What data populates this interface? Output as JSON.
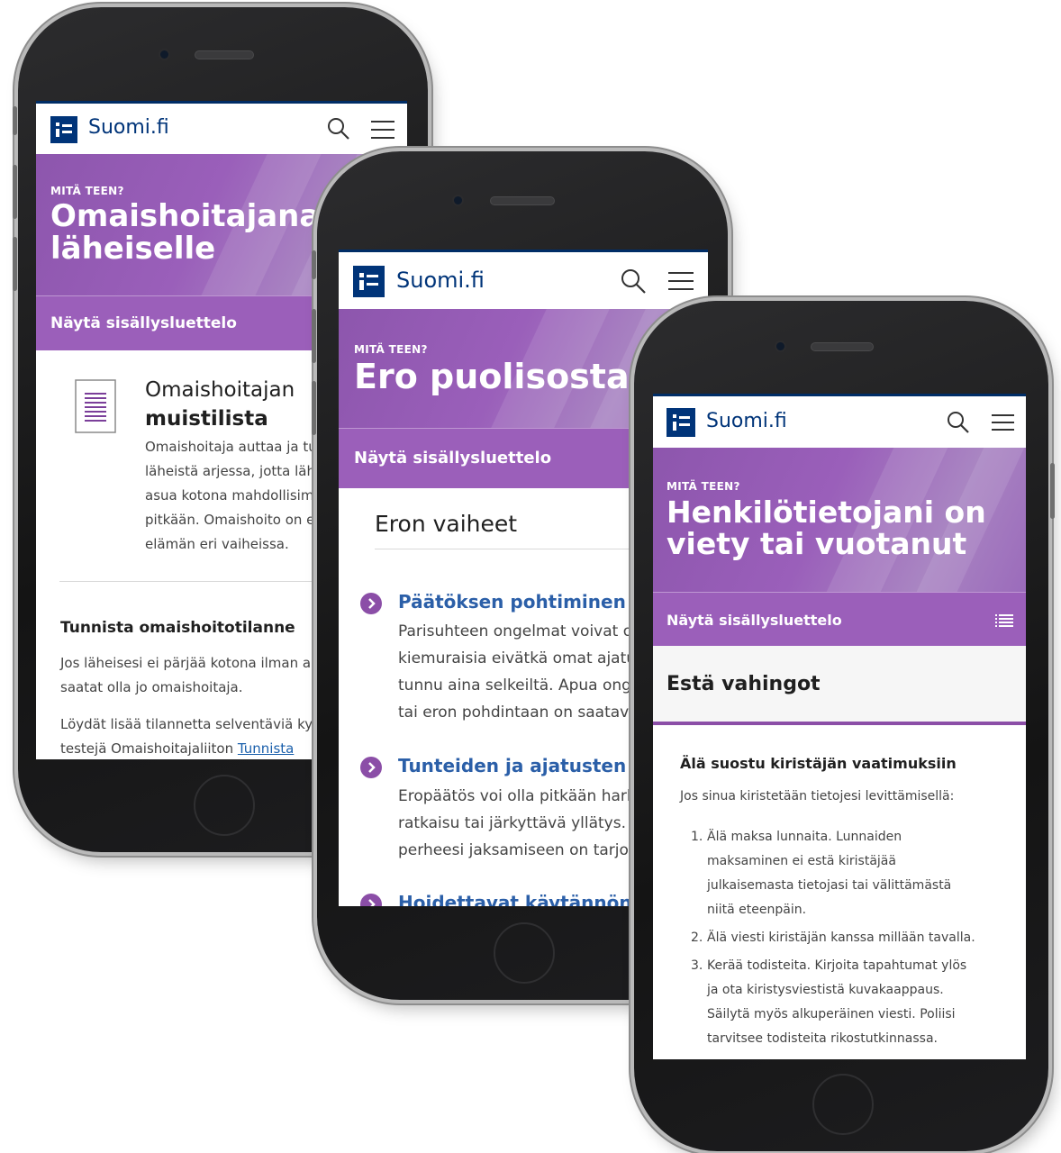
{
  "colors": {
    "brand": "#003479",
    "hero": "#9a5fba",
    "toc": "#9b5fba",
    "link": "#2b5fa8",
    "accent": "#8b4ea7"
  },
  "phone1": {
    "logo": "Suomi.fi",
    "eyebrow": "MITÄ TEEN?",
    "title_line1": "Omaishoitajana",
    "title_line2": "läheiselle",
    "toc_label": "Näytä sisällysluettelo",
    "card_title_line1": "Omaishoitajan",
    "card_title_line2": "muistilista",
    "card_lines": [
      "Omaishoitaja auttaa ja tu",
      "läheistä arjessa, jotta läh",
      "asua kotona mahdollisim",
      "pitkään. Omaishoito on e",
      "elämän eri vaiheissa."
    ],
    "section_title": "Tunnista omaishoitotilanne",
    "para1_lines": [
      "Jos läheisesi ei pärjää kotona ilman ap",
      "saatat olla jo omaishoitaja."
    ],
    "para2_line1": "Löydät lisää tilannetta selventäviä kys",
    "para2_line2_prefix": "testejä Omaishoitajaliiton ",
    "para2_link": "Tunnista"
  },
  "phone2": {
    "logo": "Suomi.fi",
    "eyebrow": "MITÄ TEEN?",
    "title": "Ero puolisosta",
    "toc_label": "Näytä sisällysluettelo",
    "section_title": "Eron vaiheet",
    "steps": [
      {
        "title": "Päätöksen pohtiminen",
        "lines": [
          "Parisuhteen ongelmat voivat oll",
          "kiemuraisia eivätkä omat ajatuk",
          "tunnu aina selkeiltä. Apua ongel",
          "tai eron pohdintaan on saatavill"
        ]
      },
      {
        "title": "Tunteiden ja ajatusten käsit",
        "lines": [
          "Eropäätös voi olla pitkään harki",
          "ratkaisu tai järkyttävä yllätys. Si",
          "perheesi jaksamiseen on tarjolla"
        ]
      },
      {
        "title": "Hoidettavat käytännön asia",
        "lines": []
      }
    ]
  },
  "phone3": {
    "logo": "Suomi.fi",
    "eyebrow": "MITÄ TEEN?",
    "title_line1": "Henkilötietojani on",
    "title_line2": "viety tai vuotanut",
    "toc_label": "Näytä sisällysluettelo",
    "section_title": "Estä vahingot",
    "subheading": "Älä suostu kiristäjän vaatimuksiin",
    "intro": "Jos sinua kiristetään tietojesi levittämisellä:",
    "list": [
      {
        "num": "1.",
        "lines": [
          "Älä maksa lunnaita. Lunnaiden",
          "maksaminen ei estä kiristäjää",
          "julkaisemasta tietojasi tai välittämästä",
          "niitä eteenpäin."
        ]
      },
      {
        "num": "2.",
        "lines": [
          "Älä viesti kiristäjän kanssa millään tavalla."
        ]
      },
      {
        "num": "3.",
        "lines": [
          "Kerää todisteita. Kirjoita tapahtumat ylös",
          "ja ota kiristysviestistä kuvakaappaus.",
          "Säilytä myös alkuperäinen viesti. Poliisi",
          "tarvitsee todisteita rikostutkinnassa."
        ]
      }
    ]
  }
}
